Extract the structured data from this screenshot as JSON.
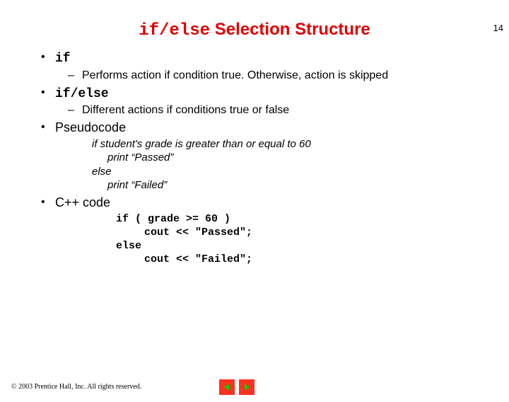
{
  "page_number": "14",
  "title": {
    "code": "if/else",
    "rest": " Selection Structure"
  },
  "bullets": {
    "b1": {
      "code": "if"
    },
    "b1_sub": "Performs action if condition true. Otherwise, action is skipped",
    "b2": {
      "code": "if/else"
    },
    "b2_sub": "Different actions if conditions true or false",
    "b3": "Pseudocode",
    "pseudo": {
      "l1": "if student's grade is greater than or equal to 60",
      "l2": "print “Passed”",
      "l3": "else",
      "l4": "print “Failed”"
    },
    "b4": "C++ code",
    "code": {
      "l1": "if ( grade >= 60 )",
      "l2": "cout << \"Passed\";",
      "l3": "else",
      "l4": "cout << \"Failed\";"
    }
  },
  "footer": "© 2003 Prentice Hall, Inc.  All rights reserved.",
  "chart_data": null
}
